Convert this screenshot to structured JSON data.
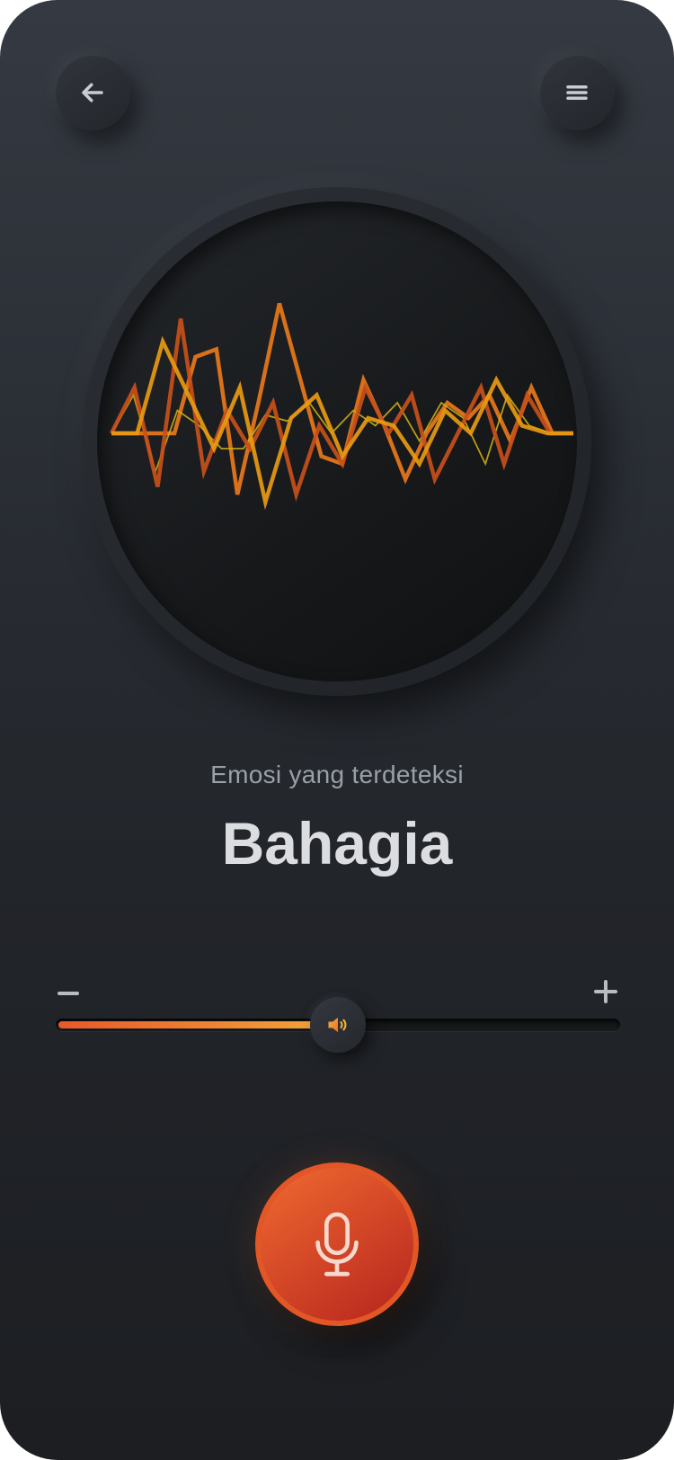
{
  "header": {
    "back_icon": "arrow-left-icon",
    "menu_icon": "hamburger-menu-icon"
  },
  "visualizer": {
    "colors": [
      "#e8781a",
      "#d4b414",
      "#c8501a",
      "#e89a12"
    ],
    "waves": [
      [
        0,
        0,
        0.0,
        0,
        0.5,
        0.55,
        -0.4,
        0.2,
        0.85,
        0.35,
        -0.15,
        -0.2,
        0.35,
        0.05,
        -0.3,
        0.0,
        0.2,
        0.1,
        0.25,
        -0.05,
        0.3,
        0.0,
        0.0
      ],
      [
        0,
        0.25,
        -0.25,
        0.15,
        0.05,
        -0.1,
        -0.1,
        0.12,
        0.08,
        0.2,
        0.0,
        0.15,
        0.05,
        0.2,
        -0.05,
        0.2,
        0.1,
        -0.2,
        0.25,
        0.05,
        0.0,
        0.0
      ],
      [
        0,
        0.3,
        -0.35,
        0.75,
        -0.25,
        0.15,
        -0.1,
        0.2,
        -0.4,
        0.05,
        -0.2,
        0.3,
        0.0,
        0.25,
        -0.3,
        0.0,
        0.3,
        -0.2,
        0.25,
        0.0,
        0.0
      ],
      [
        0,
        0,
        0.6,
        0.25,
        -0.1,
        0.3,
        -0.45,
        0.1,
        0.25,
        -0.15,
        0.1,
        0.05,
        -0.2,
        0.15,
        0.0,
        0.35,
        0.05,
        0.0,
        0.0
      ]
    ]
  },
  "emotion": {
    "caption": "Emosi yang terdeteksi",
    "value": "Bahagia"
  },
  "volume": {
    "level": 0.5,
    "thumb_icon": "speaker-icon",
    "minus_icon": "minus-icon",
    "plus_icon": "plus-icon",
    "accent_start": "#e9582a",
    "accent_end": "#f2a83a"
  },
  "record": {
    "icon": "microphone-icon",
    "color": "#e35626"
  }
}
